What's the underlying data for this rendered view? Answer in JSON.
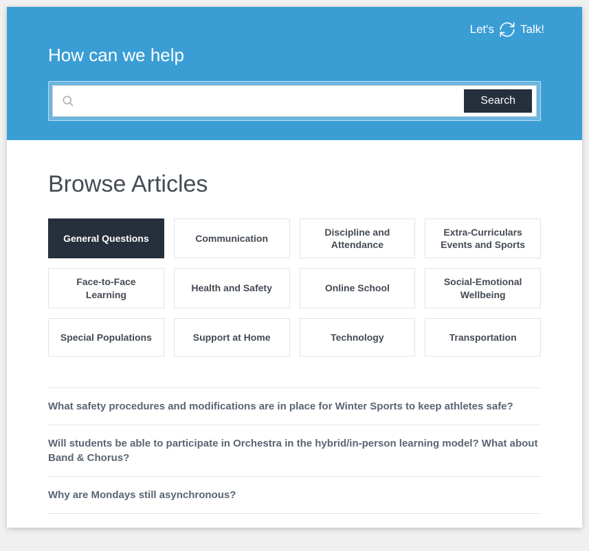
{
  "header": {
    "lets_talk_prefix": "Let's",
    "lets_talk_suffix": "Talk!",
    "title": "How can we help",
    "search_placeholder": "",
    "search_button": "Search"
  },
  "browse": {
    "title": "Browse Articles",
    "categories": [
      {
        "label": "General Questions",
        "active": true
      },
      {
        "label": "Communication",
        "active": false
      },
      {
        "label": "Discipline and Attendance",
        "active": false
      },
      {
        "label": "Extra-Curriculars Events and Sports",
        "active": false
      },
      {
        "label": "Face-to-Face Learning",
        "active": false
      },
      {
        "label": "Health and Safety",
        "active": false
      },
      {
        "label": "Online School",
        "active": false
      },
      {
        "label": "Social-Emotional Wellbeing",
        "active": false
      },
      {
        "label": "Special Populations",
        "active": false
      },
      {
        "label": "Support at Home",
        "active": false
      },
      {
        "label": "Technology",
        "active": false
      },
      {
        "label": "Transportation",
        "active": false
      }
    ]
  },
  "articles": [
    "What safety procedures and modifications are in place for Winter Sports to keep athletes safe?",
    "Will students be able to participate in Orchestra in the hybrid/in-person learning model? What about Band & Chorus?",
    "Why are Mondays still asynchronous?"
  ]
}
